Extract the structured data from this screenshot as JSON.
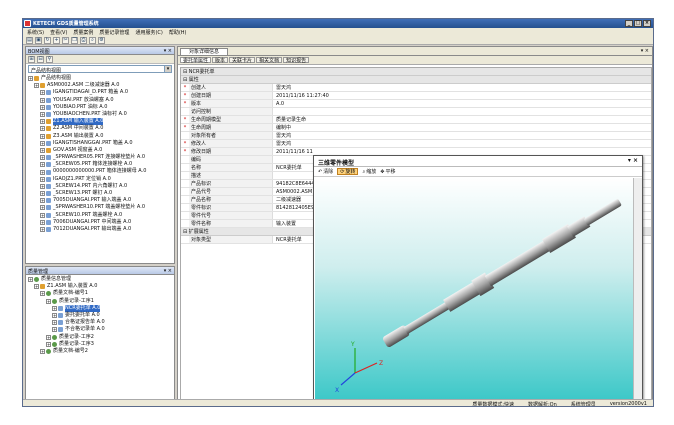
{
  "window": {
    "title": "KETECH GDS质量管理系统"
  },
  "menu": [
    "系统(S)",
    "查看(V)",
    "质量案例",
    "质量记录管理",
    "通用服务(C)",
    "帮助(H)"
  ],
  "bom_panel": {
    "title": "BOM视图",
    "view_select": "产品结构视图",
    "tree": [
      {
        "label": "产品结构视图",
        "level": 0,
        "icon": "asm"
      },
      {
        "label": "ASM0002.ASM 二级减速器 A.0",
        "level": 1,
        "icon": "asm"
      },
      {
        "label": "IGANGTIDAGAI_D.PRT 箱盖 A.0",
        "level": 2,
        "icon": "part"
      },
      {
        "label": "YOUSAI.PRT 放油螺塞 A.0",
        "level": 2,
        "icon": "part"
      },
      {
        "label": "YOUBIAO.PRT 油标 A.0",
        "level": 2,
        "icon": "part"
      },
      {
        "label": "YOUBIAOCHEN.PRT 油标衬 A.0",
        "level": 2,
        "icon": "part"
      },
      {
        "label": "Z1.ASM 输入装置 A.0",
        "level": 2,
        "icon": "asm",
        "selected": true
      },
      {
        "label": "Z2.ASM 中间装置 A.0",
        "level": 2,
        "icon": "asm"
      },
      {
        "label": "Z3.ASM 输出装置 A.0",
        "level": 2,
        "icon": "asm"
      },
      {
        "label": "IGANGTISHANGGAI.PRT 箱盖 A.0",
        "level": 2,
        "icon": "part"
      },
      {
        "label": "GOV.ASM 视窗盖 A.0",
        "level": 2,
        "icon": "asm"
      },
      {
        "label": "_SPRWASHER05.PRT 连接螺栓垫片 A.0",
        "level": 2,
        "icon": "part"
      },
      {
        "label": "_SCREW05.PRT 箱体连接螺栓 A.0",
        "level": 2,
        "icon": "part"
      },
      {
        "label": "0000000000000.PRT 箱体连接螺母 A.0",
        "level": 2,
        "icon": "part"
      },
      {
        "label": "IGAOJZ1.PRT 定位销 A.0",
        "level": 2,
        "icon": "part"
      },
      {
        "label": "_SCREW14.PRT 内六角螺钉 A.0",
        "level": 2,
        "icon": "part"
      },
      {
        "label": "_SCREW13.PRT 螺钉 A.0",
        "level": 2,
        "icon": "part"
      },
      {
        "label": "7005DUANGAI.PRT 输入端盖 A.0",
        "level": 2,
        "icon": "part"
      },
      {
        "label": "_SPRWASHER10.PRT 端盖螺栓垫片 A.0",
        "level": 2,
        "icon": "part"
      },
      {
        "label": "_SCREW10.PRT 端盖螺栓 A.0",
        "level": 2,
        "icon": "part"
      },
      {
        "label": "7006DUANGAI.PRT 中间端盖 A.0",
        "level": 2,
        "icon": "part"
      },
      {
        "label": "7012DUANGAI.PRT 输出端盖 A.0",
        "level": 2,
        "icon": "part"
      }
    ]
  },
  "quality_panel": {
    "title": "质量管理",
    "tree": [
      {
        "label": "质量信息管理",
        "level": 0,
        "icon": "q"
      },
      {
        "label": "Z1.ASM 输入装置 A.0",
        "level": 1,
        "icon": "asm"
      },
      {
        "label": "质量文档-编号1",
        "level": 2,
        "icon": "q"
      },
      {
        "label": "质量记录-工序1",
        "level": 3,
        "icon": "q"
      },
      {
        "label": "NCR委托单 A.0",
        "level": 4,
        "icon": "part",
        "selected": true
      },
      {
        "label": "委托委托单 A.0",
        "level": 4,
        "icon": "part"
      },
      {
        "label": "合格证报告单 A.0",
        "level": 4,
        "icon": "part"
      },
      {
        "label": "不合格记录单 A.0",
        "level": 4,
        "icon": "part"
      },
      {
        "label": "质量记录-工序2",
        "level": 3,
        "icon": "q"
      },
      {
        "label": "质量记录-工序3",
        "level": 3,
        "icon": "q"
      },
      {
        "label": "质量文档-编号2",
        "level": 2,
        "icon": "q"
      }
    ]
  },
  "main": {
    "doc_tab": "对象详细信息",
    "subtabs": [
      "委托单属性",
      "版本",
      "关联卡片",
      "相关文档",
      "知识报告"
    ],
    "header_row": "NCR委托单",
    "categories": {
      "basic": "属性",
      "ext": "扩展属性"
    },
    "props": [
      {
        "name": "创建人",
        "value": "雷天鸿",
        "req": true
      },
      {
        "name": "创建日期",
        "value": "2011/11/16 11:27:40",
        "req": true
      },
      {
        "name": "版本",
        "value": "A.0",
        "req": true
      },
      {
        "name": "访问控制",
        "value": "",
        "req": false
      },
      {
        "name": "生命周期模型",
        "value": "质量记录生命",
        "req": true
      },
      {
        "name": "生命周期",
        "value": "编制中",
        "req": true
      },
      {
        "name": "对象所有者",
        "value": "雷天鸿",
        "req": false
      },
      {
        "name": "修改人",
        "value": "雷天鸿",
        "req": true
      },
      {
        "name": "修改日期",
        "value": "2011/11/16 11",
        "req": true
      },
      {
        "name": "编码",
        "value": "",
        "req": false
      },
      {
        "name": "名称",
        "value": "NCR委托单",
        "req": false
      },
      {
        "name": "描述",
        "value": "",
        "req": false
      },
      {
        "name": "产品标识",
        "value": "94182C8E6444",
        "req": false
      },
      {
        "name": "产品代号",
        "value": "ASM0002.ASM",
        "req": false
      },
      {
        "name": "产品名称",
        "value": "二级减速器",
        "req": false
      },
      {
        "name": "零件标识",
        "value": "8142812405E9C",
        "req": false
      },
      {
        "name": "零件代号",
        "value": "",
        "req": false
      },
      {
        "name": "零件名称",
        "value": "输入装置",
        "req": false
      }
    ],
    "ext_props": [
      {
        "name": "对象类型",
        "value": "NCR委托单"
      }
    ]
  },
  "viewer": {
    "title": "三维零件模型",
    "tools": [
      "清除",
      "旋转",
      "缩放",
      "平移"
    ],
    "active_tool": "旋转",
    "axes": {
      "x": "X",
      "y": "Y",
      "z": "Z"
    }
  },
  "status": [
    "质量数据模式:快速",
    "数据解析:On",
    "系统管理员",
    "version2000v1"
  ],
  "colors": {
    "title_bar": "#2c5aa0",
    "selection": "#316ac5",
    "viewer_bg_bottom": "#3cc8c8"
  }
}
